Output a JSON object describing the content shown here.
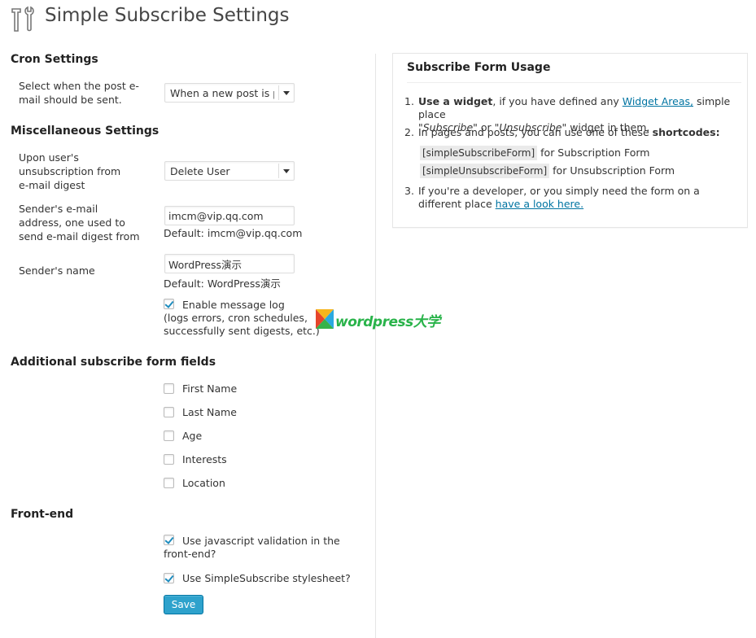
{
  "page": {
    "title": "Simple Subscribe Settings",
    "icon": "tools-icon"
  },
  "cron": {
    "title": "Cron Settings",
    "label": "Select when the post e-mail should be sent.",
    "select_value": "When a new post is pu"
  },
  "misc": {
    "title": "Miscellaneous Settings",
    "unsub_label": "Upon user's unsubscription from e-mail digest",
    "unsub_value": "Delete User",
    "email_label": "Sender's e-mail address, one used to send e-mail digest from",
    "email_value": "imcm@vip.qq.com",
    "email_default": "Default: imcm@vip.qq.com",
    "name_label": "Sender's name",
    "name_value": "WordPress演示",
    "name_default": "Default: WordPress演示",
    "log_label": "Enable message log",
    "log_note": "(logs errors, cron schedules, successfully sent digests, etc.)",
    "log_checked": true
  },
  "additional": {
    "title": "Additional subscribe form fields",
    "fields": [
      {
        "label": "First Name",
        "checked": false
      },
      {
        "label": "Last Name",
        "checked": false
      },
      {
        "label": "Age",
        "checked": false
      },
      {
        "label": "Interests",
        "checked": false
      },
      {
        "label": "Location",
        "checked": false
      }
    ]
  },
  "frontend": {
    "title": "Front-end",
    "js_label": "Use javascript validation in the front-end?",
    "js_checked": true,
    "css_label": "Use SimpleSubscribe stylesheet?",
    "css_checked": true,
    "save_label": "Save"
  },
  "usage": {
    "title": "Subscribe Form Usage",
    "item1_bold": "Use a widget",
    "item1_text1": ", if you have defined any ",
    "item1_link": "Widget Areas,",
    "item1_text2": " simple place",
    "item1_em1": "\"Subscribe\"",
    "item1_text3": " or ",
    "item1_em2": "\"Unsubscribe\"",
    "item1_text4": " widget in them.",
    "item2_text": "In pages and posts, you can use one of these ",
    "item2_bold": "shortcodes:",
    "code1": "[simpleSubscribeForm]",
    "code1_desc": " for Subscription Form",
    "code2": "[simpleUnsubscribeForm]",
    "code2_desc": " for Unsubscription Form",
    "item3_text": "If you're a developer, or you simply need the form on a different place ",
    "item3_link": "have a look here.",
    "num1": "1.",
    "num2": "2.",
    "num3": "3."
  },
  "watermark": {
    "text": "wordpress大学"
  },
  "colors": {
    "primary_button": "#2ea2cc",
    "link": "#0074a2",
    "check": "#1e8cbe"
  }
}
